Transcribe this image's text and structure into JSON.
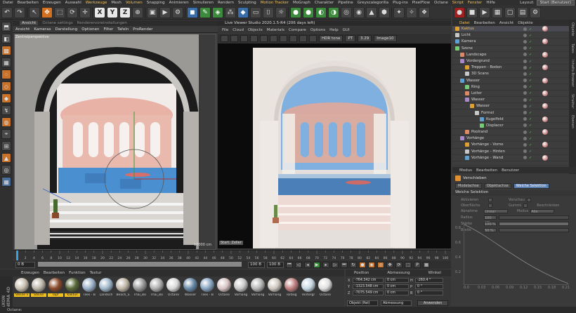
{
  "menubar": {
    "items": [
      "Datei",
      "Bearbeiten",
      "Erzeugen",
      "Auswahl",
      "Werkzeuge",
      "Mesh",
      "Volumen",
      "Snapping",
      "Animieren",
      "Simulieren",
      "Rendern",
      "Sculpting",
      "Motion Tracker",
      "MoGraph",
      "Charakter",
      "Pipeline",
      "Greyscalegorilla",
      "Plug-ins",
      "PixelFlow",
      "Octane",
      "Skript",
      "Fenster",
      "Hilfe"
    ],
    "highlight": [
      "Skript",
      "Fenster",
      "Motion Tracker",
      "Werkzeuge",
      "Volumen"
    ],
    "layout_label": "Layout:",
    "layout_value": "Start (Benutzer)"
  },
  "toolbar": {
    "axis_x": "X",
    "axis_y": "Y",
    "axis_z": "Z"
  },
  "viewport": {
    "tabs": [
      "Ansicht",
      "Octane settings",
      "Renderervoreinstellungen"
    ],
    "menu": [
      "Ansicht",
      "Kameras",
      "Darstellung",
      "Optionen",
      "Filter",
      "Tafeln",
      "ProRender"
    ],
    "label": "Zentralperspektive",
    "scale": "10000 cm"
  },
  "live_viewer": {
    "title": "Live Viewer Studio 2020.1.5-R4 (206 days left)",
    "menu": [
      "File",
      "Cloud",
      "Objects",
      "Materials",
      "Compare",
      "Options",
      "Help",
      "GUI"
    ],
    "tone": "HDR tone",
    "mode": "PT",
    "value": "3.29",
    "image": "Image10",
    "start_label": "Start. Zeller"
  },
  "object_manager": {
    "tabs": [
      "Datei",
      "Bearbeiten",
      "Ansicht",
      "Objekte"
    ],
    "rows": [
      {
        "name": "Kaktus",
        "indent": 0,
        "sel": true
      },
      {
        "name": "Licht",
        "indent": 0
      },
      {
        "name": "Kamera",
        "indent": 0
      },
      {
        "name": "Szene",
        "indent": 0
      },
      {
        "name": "Landscape",
        "indent": 1
      },
      {
        "name": "Vordergrund",
        "indent": 1
      },
      {
        "name": "Treppen - Boden",
        "indent": 2
      },
      {
        "name": "3D Scans",
        "indent": 2
      },
      {
        "name": "Wasser",
        "indent": 1
      },
      {
        "name": "Ring",
        "indent": 2
      },
      {
        "name": "Leiter",
        "indent": 2
      },
      {
        "name": "Wasser",
        "indent": 2
      },
      {
        "name": "Wasser",
        "indent": 3
      },
      {
        "name": "Formel",
        "indent": 4
      },
      {
        "name": "Kugelfeld",
        "indent": 5
      },
      {
        "name": "Displacer",
        "indent": 5
      },
      {
        "name": "Poolrand",
        "indent": 2
      },
      {
        "name": "Vorhänge",
        "indent": 1
      },
      {
        "name": "Vorhänge - Vorne",
        "indent": 2
      },
      {
        "name": "Vorhänge - Hinten",
        "indent": 2
      },
      {
        "name": "Vorhänge - Wand",
        "indent": 2
      }
    ]
  },
  "right_strip": [
    "Objekte",
    "Takes",
    "Inhalts-Browser",
    "Struktur",
    "Ebenen"
  ],
  "attribute_manager": {
    "tabs": [
      "Modus",
      "Bearbeiten",
      "Benutzer"
    ],
    "title": "Verschieben",
    "subtabs": [
      "Modelachse",
      "Objektachse",
      "Weiche Selektion"
    ],
    "active_subtab": "Weiche Selektion",
    "section": "Weiche Selektion",
    "rows": [
      {
        "label": "Aktivieren",
        "label2": "Vorschau"
      },
      {
        "label": "Oberfläche",
        "label2": "Gummi",
        "label3": "Beschränken"
      },
      {
        "label": "Abnahme",
        "value": "Linear",
        "label2": "Modus",
        "value2": "Alle"
      },
      {
        "label": "Radius",
        "value": "100 cm"
      },
      {
        "label": "Stärke",
        "value": "100 %"
      },
      {
        "label": "Breite",
        "value": "50 %"
      }
    ],
    "graph_y": [
      "0.8",
      "0.6",
      "0.4",
      "0.2"
    ],
    "graph_x": [
      "0.0",
      "0.03",
      "0.06",
      "0.09",
      "0.12",
      "0.15",
      "0.18",
      "0.21"
    ]
  },
  "timeline": {
    "ticks": [
      "0",
      "2",
      "4",
      "6",
      "8",
      "10",
      "12",
      "14",
      "16",
      "18",
      "20",
      "22",
      "24",
      "26",
      "28",
      "30",
      "32",
      "34",
      "36",
      "38",
      "40",
      "42",
      "44",
      "46",
      "48",
      "50",
      "52",
      "54",
      "56",
      "58",
      "60",
      "62",
      "64",
      "66",
      "68",
      "70",
      "72",
      "74",
      "76",
      "78",
      "80",
      "82",
      "84",
      "86",
      "88",
      "90",
      "92",
      "94",
      "96",
      "98",
      "100"
    ],
    "start": "0 B",
    "current": "100 B",
    "end": "100 B",
    "frame": "0 B"
  },
  "material_manager": {
    "menu": [
      "Erzeugen",
      "Bearbeiten",
      "Funktion",
      "Textur"
    ],
    "brand": "MAXON CINEMA 4D",
    "materials": [
      {
        "name": "Steine v",
        "color": "#c9c0b0",
        "selected": true
      },
      {
        "name": "Steine",
        "color": "#bdb6aa",
        "selected": true
      },
      {
        "name": "Topf",
        "color": "#8a4a2a",
        "selected": true
      },
      {
        "name": "Kaktus",
        "color": "#5a6a3a",
        "selected": true
      },
      {
        "name": "Tiles - B",
        "color": "#9ab0c8"
      },
      {
        "name": "Landsch",
        "color": "#a0b8cc"
      },
      {
        "name": "Beach_S",
        "color": "#bfb6a6"
      },
      {
        "name": "Thai_Bo",
        "color": "#9a9a9a"
      },
      {
        "name": "Thai_Bo",
        "color": "#b0b0b0"
      },
      {
        "name": "Octane",
        "color": "#d8d8d8"
      },
      {
        "name": "Wasser",
        "color": "#6a8aa8"
      },
      {
        "name": "Tiles - B",
        "color": "#8aa6c4"
      },
      {
        "name": "Octane",
        "color": "#d8c4c4"
      },
      {
        "name": "Vorhäng",
        "color": "#c8c8c8"
      },
      {
        "name": "Vorhäng",
        "color": "#b8b8b8"
      },
      {
        "name": "Vorhäng",
        "color": "#d0c8c0"
      },
      {
        "name": "Torbog",
        "color": "#c08080"
      },
      {
        "name": "Hintergr",
        "color": "#c8d8e4"
      },
      {
        "name": "Octane",
        "color": "#e0e0e0"
      }
    ]
  },
  "coordinates": {
    "headers": [
      "Position",
      "Abmessung",
      "Winkel"
    ],
    "rows": [
      {
        "axis": "X",
        "pos": "-764.342 cm",
        "dim": "0 cm",
        "ang": "H",
        "angv": "-260.4 °"
      },
      {
        "axis": "Y",
        "pos": "-1323.548 cm",
        "dim": "0 cm",
        "ang": "P",
        "angv": "0 °"
      },
      {
        "axis": "Z",
        "pos": "-7075.549 cm",
        "dim": "0 cm",
        "ang": "B",
        "angv": "0 °"
      }
    ],
    "mode1": "Objekt (Rel)",
    "mode2": "Abmessung",
    "apply": "Anwenden"
  },
  "status": "Octane:"
}
